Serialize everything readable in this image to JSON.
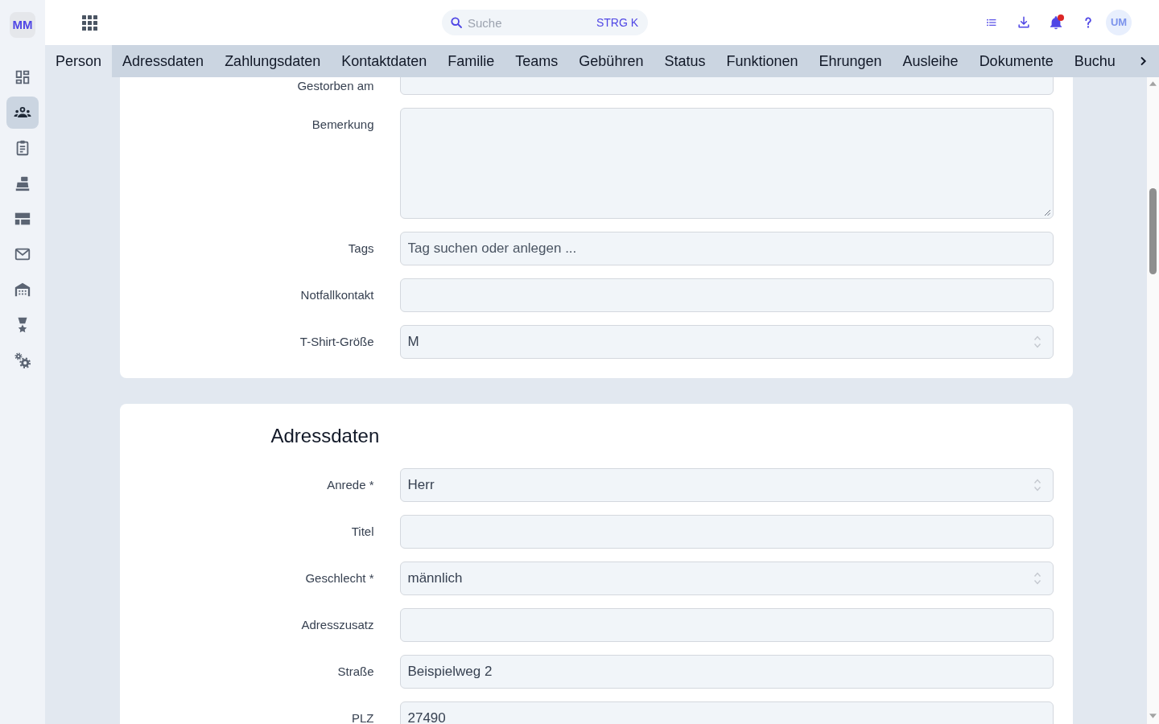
{
  "sidebar": {
    "logo": "MM",
    "items": [
      {
        "selected": false
      },
      {
        "selected": true
      },
      {
        "selected": false
      },
      {
        "selected": false
      },
      {
        "selected": false
      },
      {
        "selected": false
      },
      {
        "selected": false
      },
      {
        "selected": false
      },
      {
        "selected": false
      }
    ]
  },
  "topbar": {
    "search": {
      "placeholder": "Suche",
      "shortcut": "STRG K"
    },
    "notifications": {
      "unread": true
    },
    "user": {
      "initials": "UM"
    }
  },
  "tabs": [
    {
      "label": "Person",
      "selected": true
    },
    {
      "label": "Adressdaten",
      "selected": false
    },
    {
      "label": "Zahlungsdaten",
      "selected": false
    },
    {
      "label": "Kontaktdaten",
      "selected": false
    },
    {
      "label": "Familie",
      "selected": false
    },
    {
      "label": "Teams",
      "selected": false
    },
    {
      "label": "Gebühren",
      "selected": false
    },
    {
      "label": "Status",
      "selected": false
    },
    {
      "label": "Funktionen",
      "selected": false
    },
    {
      "label": "Ehrungen",
      "selected": false
    },
    {
      "label": "Ausleihe",
      "selected": false
    },
    {
      "label": "Dokumente",
      "selected": false
    },
    {
      "label": "Buchu",
      "selected": false
    }
  ],
  "sections": [
    {
      "fields": [
        {
          "label": "Gestorben am",
          "kind": "text"
        },
        {
          "label": "Bemerkung",
          "kind": "textarea"
        },
        {
          "label": "Tags",
          "kind": "text",
          "placeholder": "Tag suchen oder anlegen ..."
        },
        {
          "label": "Notfallkontakt",
          "kind": "text"
        },
        {
          "label": "T-Shirt-Größe",
          "kind": "select",
          "value": "M"
        }
      ]
    },
    {
      "title": "Adressdaten",
      "fields": [
        {
          "label": "Anrede *",
          "kind": "select",
          "value": "Herr"
        },
        {
          "label": "Titel",
          "kind": "text"
        },
        {
          "label": "Geschlecht *",
          "kind": "select",
          "value": "männlich"
        },
        {
          "label": "Adresszusatz",
          "kind": "text"
        },
        {
          "label": "Straße",
          "kind": "text",
          "value": "Beispielweg 2"
        },
        {
          "label": "PLZ",
          "kind": "text",
          "value": "27490"
        }
      ]
    }
  ]
}
